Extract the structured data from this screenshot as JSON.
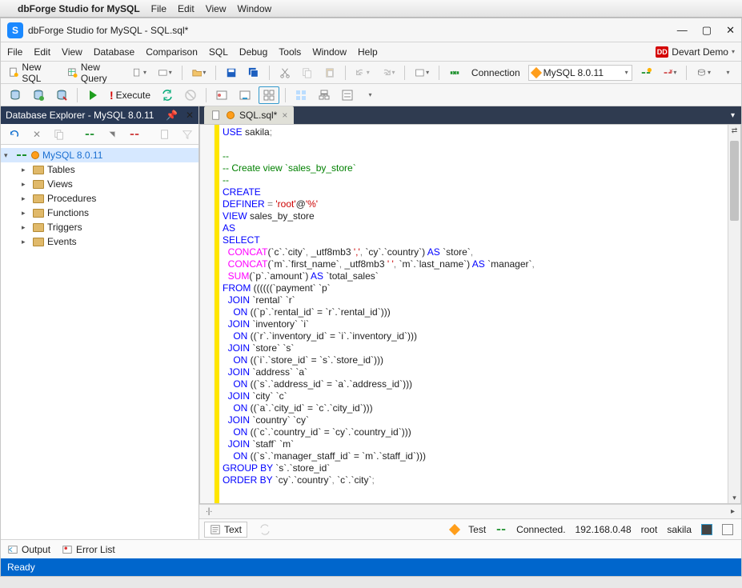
{
  "mac": {
    "app": "dbForge Studio for MySQL",
    "menus": [
      "File",
      "Edit",
      "View",
      "Window"
    ]
  },
  "window": {
    "title": "dbForge Studio for MySQL - SQL.sql*",
    "user": "Devart Demo"
  },
  "app_menu": [
    "File",
    "Edit",
    "View",
    "Database",
    "Comparison",
    "SQL",
    "Debug",
    "Tools",
    "Window",
    "Help"
  ],
  "toolbar1": {
    "newSql": "New SQL",
    "newQuery": "New Query",
    "connLabel": "Connection",
    "connValue": "MySQL 8.0.11"
  },
  "toolbar2": {
    "execute": "Execute"
  },
  "explorer": {
    "title": "Database Explorer - MySQL 8.0.11",
    "server": "MySQL 8.0.11",
    "nodes": [
      "Tables",
      "Views",
      "Procedures",
      "Functions",
      "Triggers",
      "Events"
    ]
  },
  "doc_tab": "SQL.sql*",
  "sql": {
    "l01a": "USE",
    "l01b": " sakila",
    "l01c": ";",
    "l03": "--",
    "l04": "-- Create view `sales_by_store`",
    "l05": "--",
    "l06": "CREATE",
    "l07a": "DEFINER",
    "l07b": " = ",
    "l07c": "'root'",
    "l07d": "@",
    "l07e": "'%'",
    "l08a": "VIEW",
    "l08b": " sales_by_store",
    "l09": "AS",
    "l10": "SELECT",
    "l11a": "  ",
    "l11f": "CONCAT",
    "l11b": "(`c`.`city`",
    "l11c": ",",
    "l11d": " _utf8mb3 ",
    "l11e": "','",
    "l11g": ",",
    "l11h": " `cy`.`country`) ",
    "l11i": "AS",
    "l11j": " `store`",
    "l11k": ",",
    "l12a": "  ",
    "l12f": "CONCAT",
    "l12b": "(`m`.`first_name`",
    "l12c": ",",
    "l12d": " _utf8mb3 ",
    "l12e": "' '",
    "l12g": ",",
    "l12h": " `m`.`last_name`) ",
    "l12i": "AS",
    "l12j": " `manager`",
    "l12k": ",",
    "l13a": "  ",
    "l13f": "SUM",
    "l13b": "(`p`.`amount`) ",
    "l13i": "AS",
    "l13j": " `total_sales`",
    "l14a": "FROM",
    "l14b": " ((((((`payment` `p`",
    "l15a": "  ",
    "l15j": "JOIN",
    "l15b": " `rental` `r`",
    "l16a": "    ",
    "l16j": "ON",
    "l16b": " ((`p`.`rental_id` = `r`.`rental_id`)))",
    "l17a": "  ",
    "l17j": "JOIN",
    "l17b": " `inventory` `i`",
    "l18a": "    ",
    "l18j": "ON",
    "l18b": " ((`r`.`inventory_id` = `i`.`inventory_id`)))",
    "l19a": "  ",
    "l19j": "JOIN",
    "l19b": " `store` `s`",
    "l20a": "    ",
    "l20j": "ON",
    "l20b": " ((`i`.`store_id` = `s`.`store_id`)))",
    "l21a": "  ",
    "l21j": "JOIN",
    "l21b": " `address` `a`",
    "l22a": "    ",
    "l22j": "ON",
    "l22b": " ((`s`.`address_id` = `a`.`address_id`)))",
    "l23a": "  ",
    "l23j": "JOIN",
    "l23b": " `city` `c`",
    "l24a": "    ",
    "l24j": "ON",
    "l24b": " ((`a`.`city_id` = `c`.`city_id`)))",
    "l25a": "  ",
    "l25j": "JOIN",
    "l25b": " `country` `cy`",
    "l26a": "    ",
    "l26j": "ON",
    "l26b": " ((`c`.`country_id` = `cy`.`country_id`)))",
    "l27a": "  ",
    "l27j": "JOIN",
    "l27b": " `staff` `m`",
    "l28a": "    ",
    "l28j": "ON",
    "l28b": " ((`s`.`manager_staff_id` = `m`.`staff_id`)))",
    "l29a": "GROUP BY",
    "l29b": " `s`.`store_id`",
    "l30a": "ORDER BY",
    "l30b": " `cy`.`country`",
    "l30c": ",",
    "l30d": " `c`.`city`",
    "l30e": ";"
  },
  "ed_status": {
    "text_btn": "Text",
    "test": "Test",
    "conn": "Connected.",
    "ip": "192.168.0.48",
    "user": "root",
    "db": "sakila"
  },
  "bottom": {
    "output": "Output",
    "errors": "Error List"
  },
  "status": "Ready"
}
